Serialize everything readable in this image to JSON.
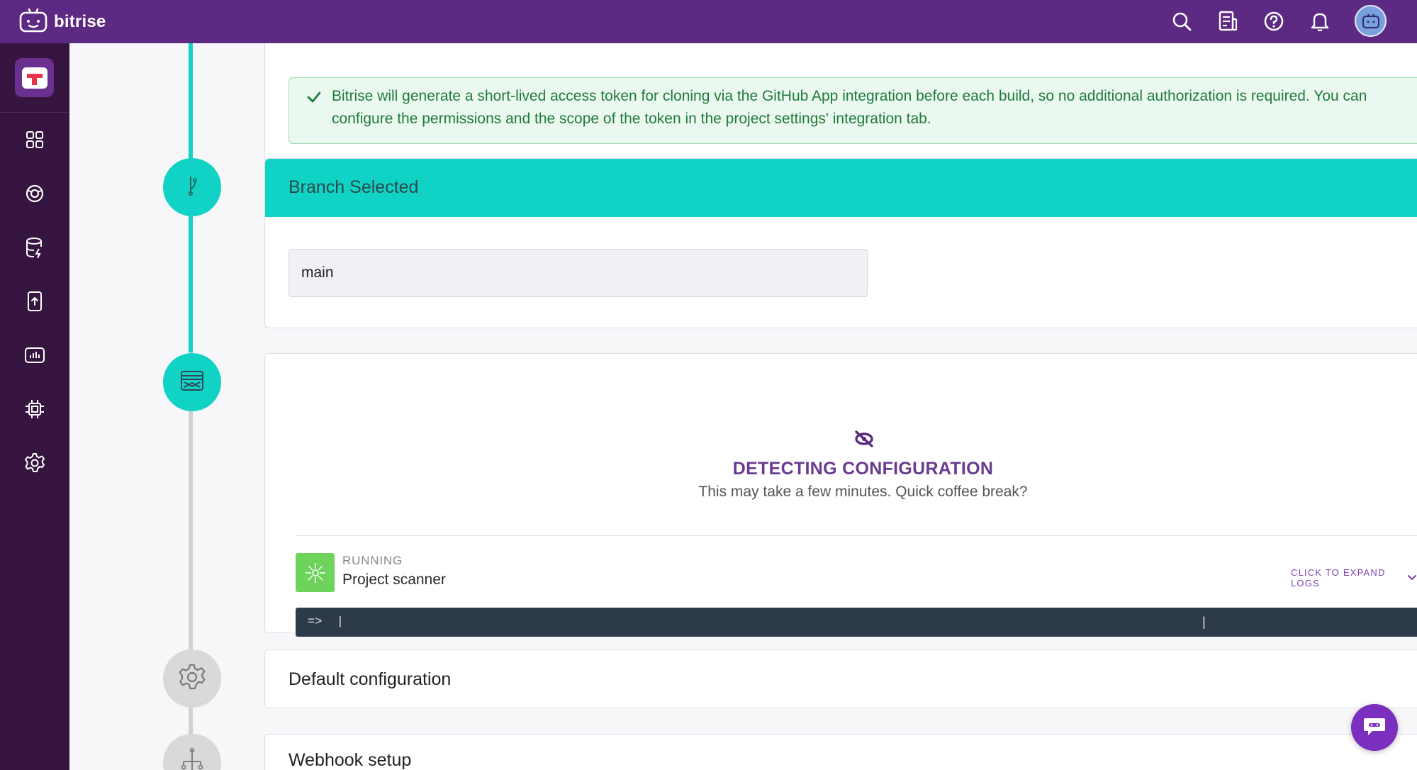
{
  "brand": {
    "name": "bitrise"
  },
  "topbar": {
    "icons": [
      "search-icon",
      "changelog-icon",
      "help-icon",
      "notifications-icon",
      "user-avatar"
    ]
  },
  "sidebar": {
    "items": [
      {
        "name": "dashboard-icon"
      },
      {
        "name": "ci-icon"
      },
      {
        "name": "build-cache-icon"
      },
      {
        "name": "release-management-icon"
      },
      {
        "name": "insights-icon"
      },
      {
        "name": "integrations-icon"
      },
      {
        "name": "settings-icon"
      }
    ]
  },
  "github_notice": {
    "text": "Bitrise will generate a short-lived access token for cloning via the GitHub App integration before each build, so no additional authorization is required. You can configure the permissions and the scope of the token in the project settings' integration tab."
  },
  "branch": {
    "title": "Branch Selected",
    "value": "main"
  },
  "detecting": {
    "title": "DETECTING CONFIGURATION",
    "subtitle": "This may take a few minutes. Quick coffee break?",
    "step_status": "RUNNING",
    "step_name": "Project scanner",
    "expand_logs": "CLICK TO EXPAND LOGS",
    "log_line": "=>  |",
    "log_caret": "|"
  },
  "steps": {
    "default_config": "Default configuration",
    "webhook_setup": "Webhook setup"
  },
  "colors": {
    "topbar": "#5c2a83",
    "sidebar": "#35153f",
    "teal": "#10d3c6",
    "purple_text": "#6a3a8f",
    "success_green": "#1f7a3c",
    "log_bg": "#2d3a4a"
  }
}
